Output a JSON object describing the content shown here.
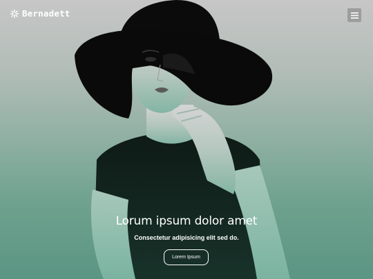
{
  "brand": {
    "name": "Bernadett",
    "icon": "sparkle-icon"
  },
  "header": {
    "menu_icon": "hamburger-menu-icon"
  },
  "hero": {
    "title": "Lorum ipsum dolor amet",
    "subtitle": "Consectetur adipisicing elit sed do.",
    "button_label": "Lorem Ipsum",
    "image": "woman-in-wide-brim-hat-photo"
  },
  "colors": {
    "gradient_top": "#c6c6c6",
    "gradient_bottom": "#5b9583",
    "text": "#ffffff",
    "menu_button_bg": "#9d9d9d"
  }
}
